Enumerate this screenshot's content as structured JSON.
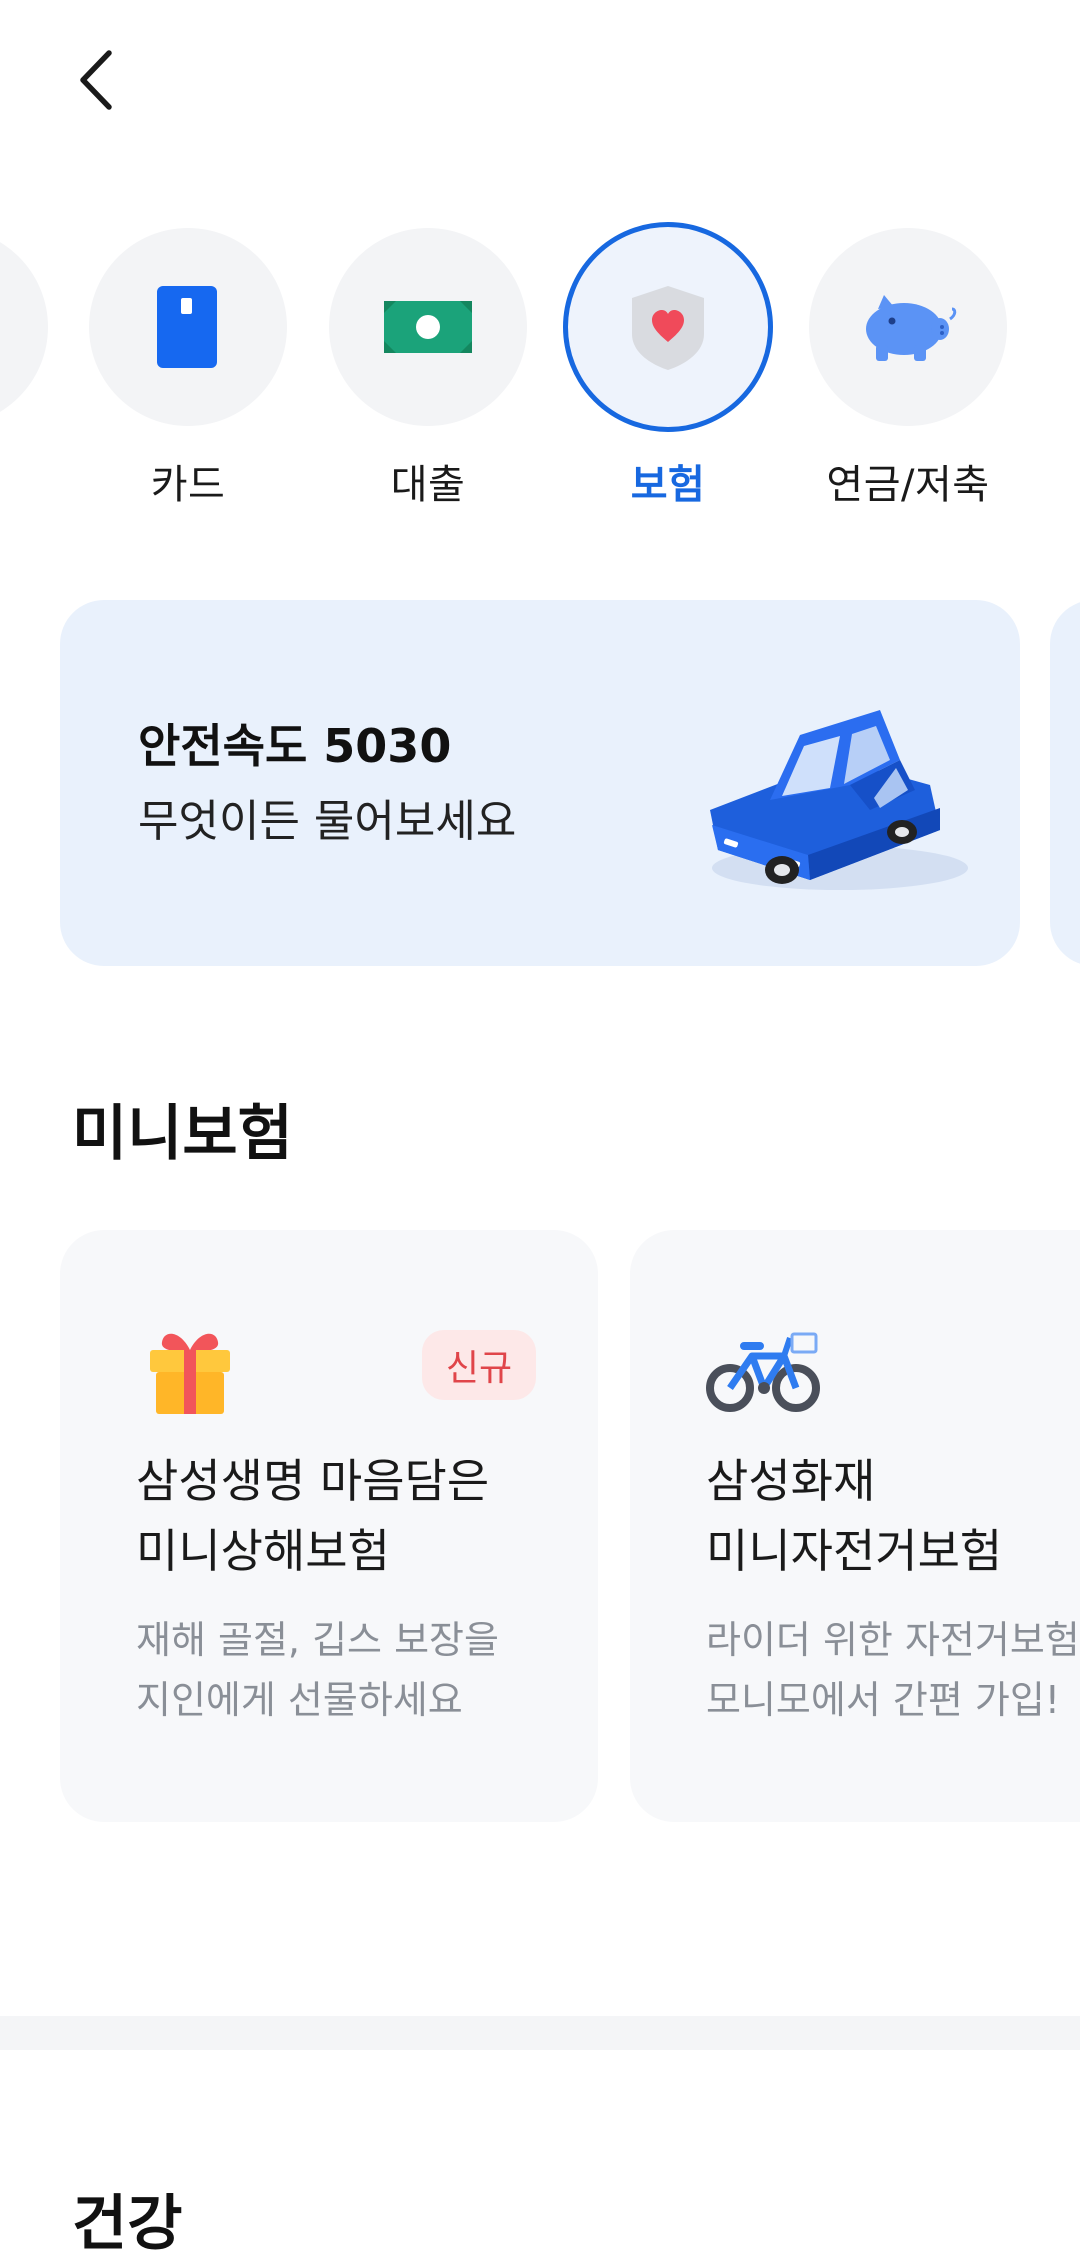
{
  "header": {
    "back_icon": "chevron-left-icon"
  },
  "categories": [
    {
      "label": "카드",
      "icon": "card-icon"
    },
    {
      "label": "대출",
      "icon": "cash-icon"
    },
    {
      "label": "보험",
      "icon": "shield-heart-icon",
      "selected": true
    },
    {
      "label": "연금/저축",
      "icon": "piggy-bank-icon"
    }
  ],
  "banner": {
    "title": "안전속도 5030",
    "subtitle": "무엇이든 물어보세요",
    "image": "blue-car-illustration"
  },
  "mini_insurance": {
    "section_title": "미니보험",
    "cards": [
      {
        "icon": "gift-icon",
        "badge": "신규",
        "title_line1": "삼성생명 마음담은",
        "title_line2": "미니상해보험",
        "desc_line1": "재해 골절, 깁스 보장을",
        "desc_line2": "지인에게 선물하세요"
      },
      {
        "icon": "bicycle-icon",
        "title_line1": "삼성화재",
        "title_line2": "미니자전거보험",
        "desc_line1": "라이더 위한 자전거보험",
        "desc_line2": "모니모에서 간편 가입!"
      }
    ]
  },
  "health": {
    "section_title": "건강"
  },
  "colors": {
    "accent": "#1768e0",
    "banner_bg": "#e9f1fc",
    "card_bg": "#f7f8fa",
    "badge_bg": "#fde8e8",
    "badge_text": "#e0454a"
  }
}
